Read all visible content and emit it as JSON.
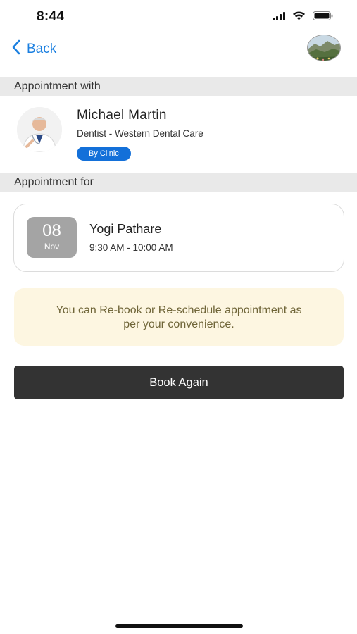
{
  "status_bar": {
    "time": "8:44"
  },
  "nav": {
    "back_label": "Back"
  },
  "sections": {
    "appointment_with": "Appointment with",
    "appointment_for": "Appointment for"
  },
  "doctor": {
    "name": "Michael Martin",
    "specialty": "Dentist - Western Dental Care",
    "mode_badge": "By Clinic"
  },
  "appointment": {
    "day": "08",
    "month": "Nov",
    "patient_name": "Yogi Pathare",
    "time": "9:30 AM - 10:00 AM"
  },
  "info": {
    "message_line1": "You can Re-book or Re-schedule appointment as",
    "message_line2": "per your convenience."
  },
  "actions": {
    "book_again_label": "Book Again"
  },
  "colors": {
    "accent_blue": "#1a7fe0",
    "badge_blue": "#1370d9",
    "button_dark": "#333333",
    "info_bg": "#fdf6e1",
    "section_bg": "#e9e9e9",
    "date_box_bg": "#a4a4a4"
  }
}
